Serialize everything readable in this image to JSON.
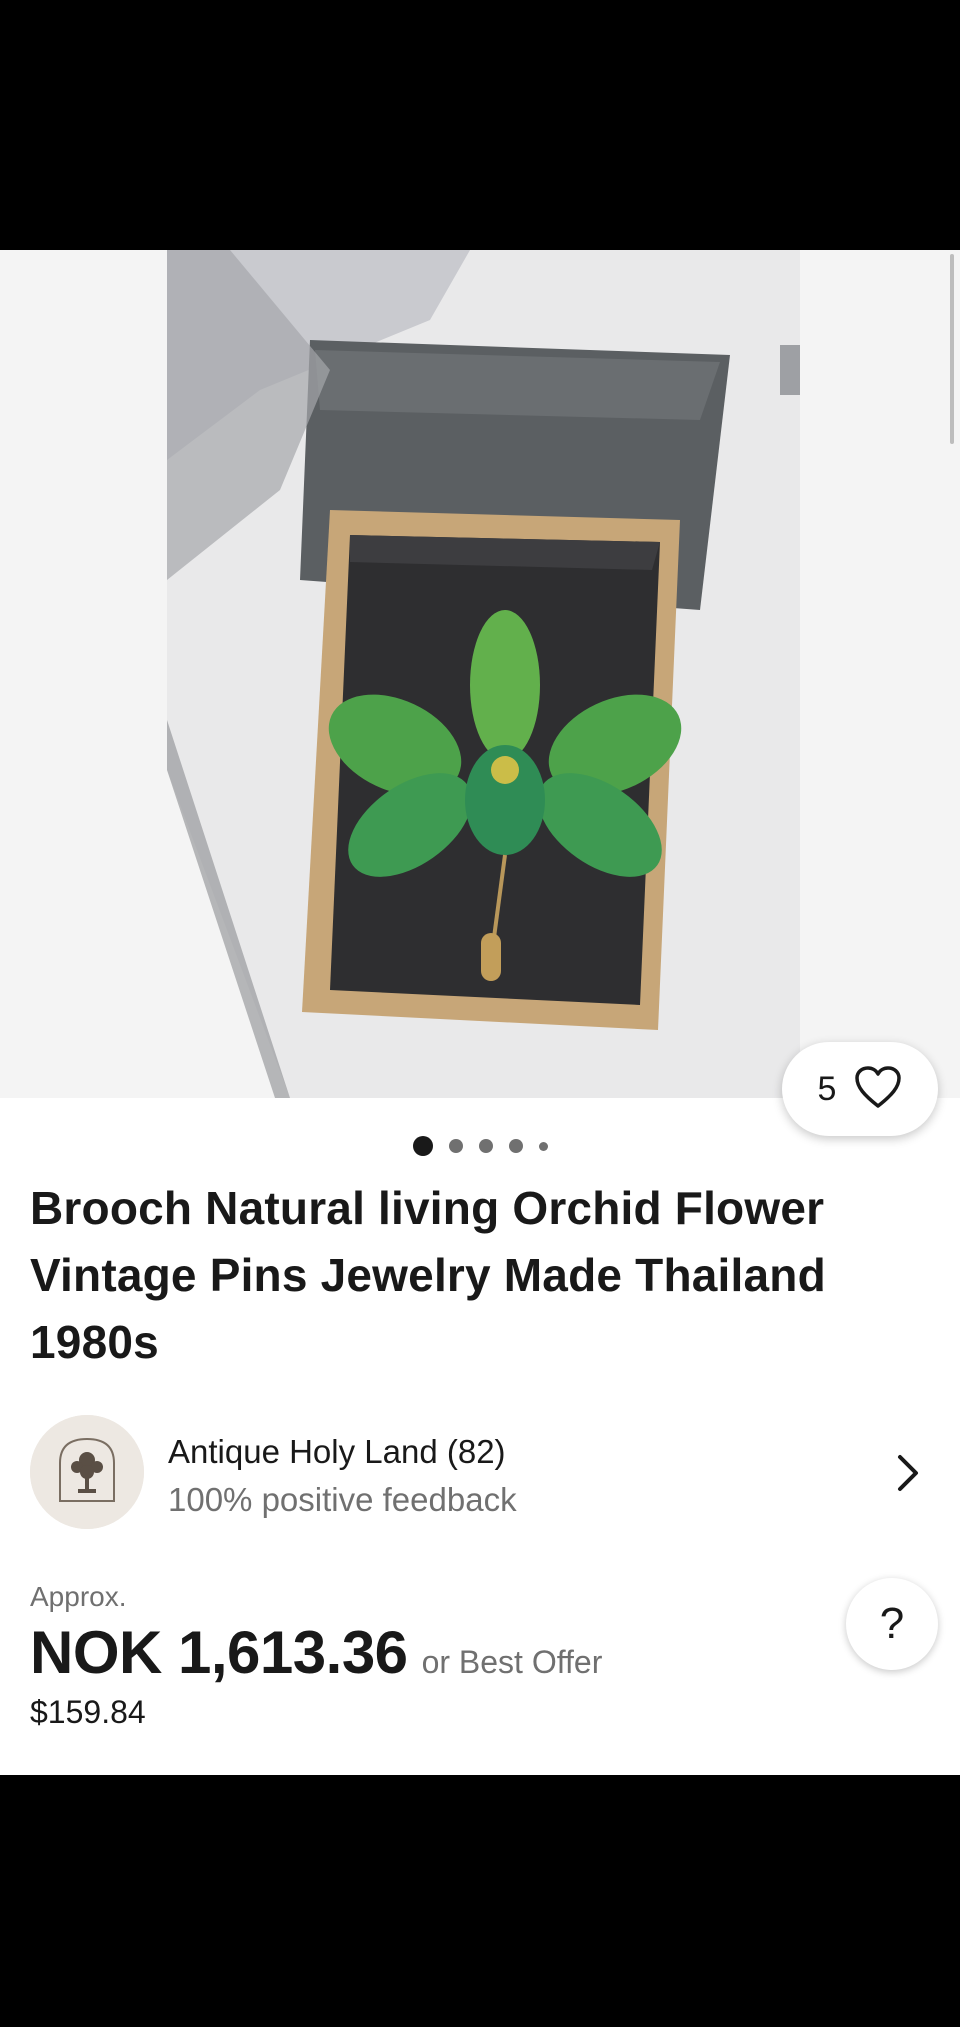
{
  "listing": {
    "title": "Brooch Natural living Orchid Flower Vintage Pins Jewelry Made Thailand 1980s",
    "image_alt_icon": "product-photo",
    "watch_count": "5",
    "carousel": {
      "total": 5,
      "active_index": 0
    }
  },
  "seller": {
    "name": "Antique Holy Land (82)",
    "feedback": "100% positive feedback",
    "avatar_logo_text": "Antique Holy Land"
  },
  "price": {
    "approx_label": "Approx.",
    "amount": "NOK 1,613.36",
    "offer": "or Best Offer",
    "original": "$159.84"
  },
  "help": {
    "label": "?"
  },
  "colors": {
    "text_primary": "#191919",
    "text_secondary": "#707070",
    "background": "#ffffff"
  }
}
